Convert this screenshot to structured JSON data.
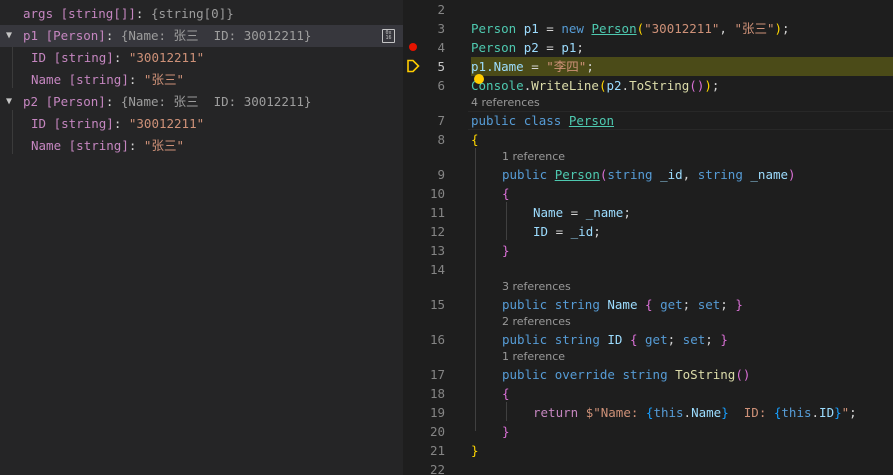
{
  "variables": {
    "rows": [
      {
        "name": "args",
        "type": "[string[]]",
        "value": "{string[0]}"
      },
      {
        "name": "p1",
        "type": "[Person]",
        "value": "{Name: 张三  ID: 30012211}",
        "expanded": true
      },
      {
        "name": "ID",
        "type": "[string]",
        "value": "\"30012211\""
      },
      {
        "name": "Name",
        "type": "[string]",
        "value": "\"张三\""
      },
      {
        "name": "p2",
        "type": "[Person]",
        "value": "{Name: 张三  ID: 30012211}",
        "expanded": true
      },
      {
        "name": "ID",
        "type": "[string]",
        "value": "\"30012211\""
      },
      {
        "name": "Name",
        "type": "[string]",
        "value": "\"张三\""
      }
    ],
    "hex_button_text": "0x\n16"
  },
  "editor": {
    "line_numbers": [
      "2",
      "3",
      "4",
      "5",
      "6",
      "7",
      "8",
      "9",
      "10",
      "11",
      "12",
      "13",
      "14",
      "15",
      "16",
      "17",
      "18",
      "19",
      "20",
      "21",
      "22"
    ],
    "refs": {
      "person_class": "4 references",
      "ctor": "1 reference",
      "name_prop": "3 references",
      "id_prop": "2 references",
      "tostring": "1 reference"
    },
    "tokens": {
      "person": "Person",
      "p1": "p1",
      "p2": "p2",
      "new": "new",
      "eq": " = ",
      "lparen": "(",
      "rparen": ")",
      "comma": ", ",
      "semi": ";",
      "id_lit": "\"30012211\"",
      "zhangsan_lit": "\"张三\"",
      "lisi_lit": "\"李四\"",
      "dot_name": ".Name",
      "name_prop": "Name",
      "id_prop": "ID",
      "console": "Console",
      "writeline": "WriteLine",
      "tostring": "ToString",
      "public": "public",
      "class": "class",
      "string": "string",
      "override": "override",
      "get": "get",
      "set": "set",
      "return": "return",
      "this": "this",
      "_id": "_id",
      "_name": "_name",
      "lbrace": "{",
      "rbrace": "}",
      "interp_start": "$\"Name: ",
      "interp_mid": "  ID: ",
      "interp_end": "\"",
      "dot": "."
    }
  }
}
